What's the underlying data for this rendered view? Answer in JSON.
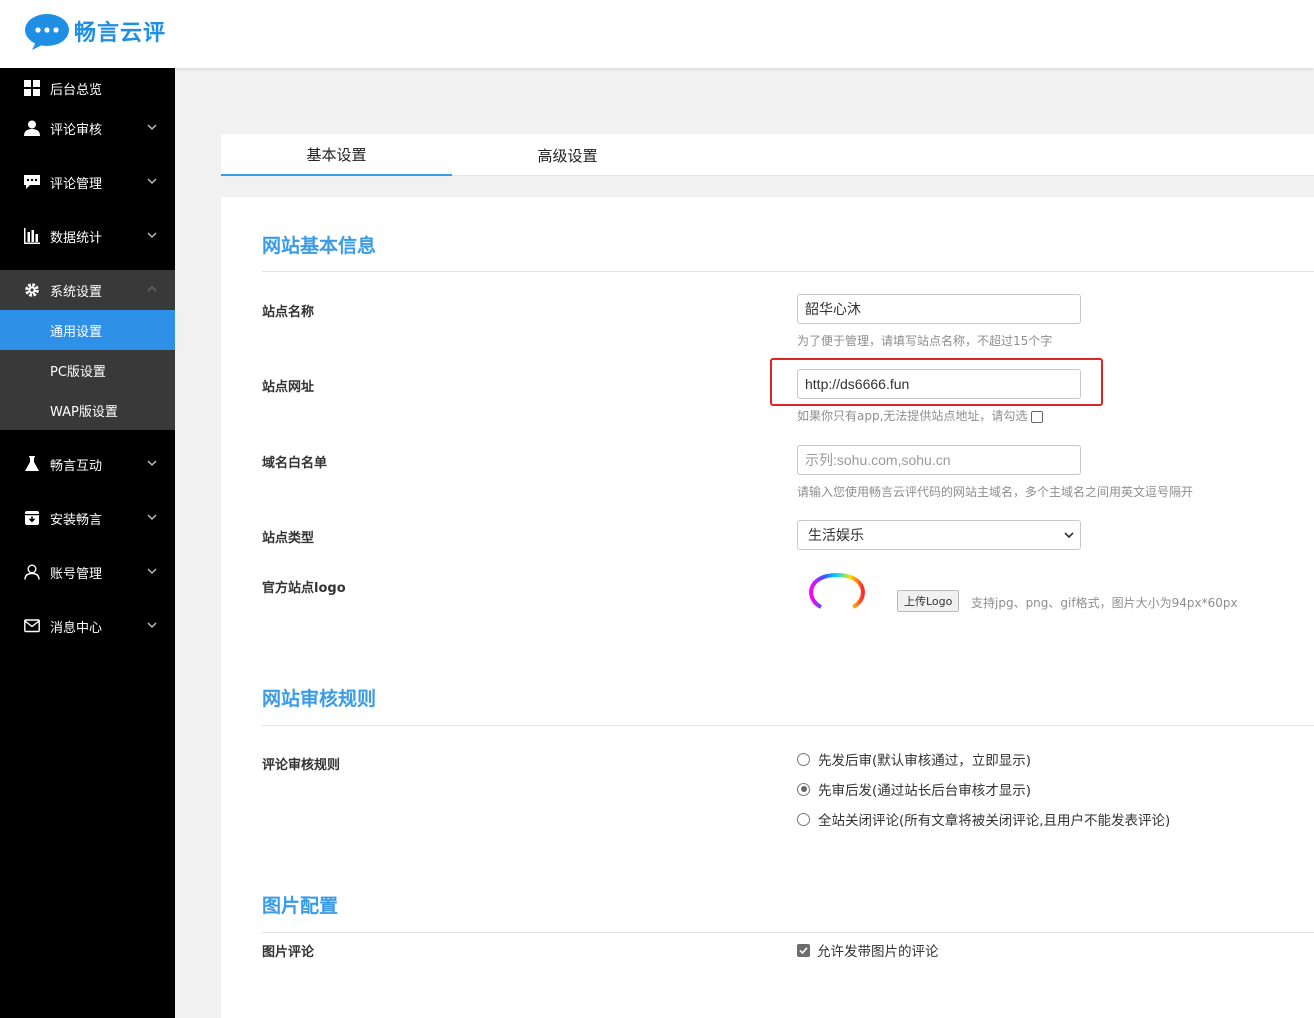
{
  "header": {
    "brand": "畅言云评"
  },
  "sidebar": {
    "items": [
      {
        "label": "后台总览",
        "icon": "dashboard-icon"
      },
      {
        "label": "评论审核",
        "icon": "user-icon"
      },
      {
        "label": "评论管理",
        "icon": "comment-icon"
      },
      {
        "label": "数据统计",
        "icon": "bar-chart-icon"
      },
      {
        "label": "系统设置",
        "icon": "gear-icon"
      },
      {
        "label": "畅言互动",
        "icon": "flask-icon"
      },
      {
        "label": "安装畅言",
        "icon": "install-icon"
      },
      {
        "label": "账号管理",
        "icon": "account-icon"
      },
      {
        "label": "消息中心",
        "icon": "mail-icon"
      }
    ],
    "sub_items": [
      "通用设置",
      "PC版设置",
      "WAP版设置"
    ]
  },
  "tabs": [
    "基本设置",
    "高级设置"
  ],
  "sections": {
    "basic_info": "网站基本信息",
    "review_rules": "网站审核规则",
    "image_config": "图片配置"
  },
  "form": {
    "site_name": {
      "label": "站点名称",
      "value": "韶华心沐",
      "hint": "为了便于管理，请填写站点名称，不超过15个字"
    },
    "site_url": {
      "label": "站点网址",
      "value": "http://ds6666.fun",
      "hint": "如果你只有app,无法提供站点地址，请勾选"
    },
    "whitelist": {
      "label": "域名白名单",
      "placeholder": "示列:sohu.com,sohu.cn",
      "hint": "请输入您使用畅言云评代码的网站主域名，多个主域名之间用英文逗号隔开"
    },
    "site_type": {
      "label": "站点类型",
      "value": "生活娱乐"
    },
    "site_logo": {
      "label": "官方站点logo",
      "button": "上传Logo",
      "hint": "支持jpg、png、gif格式，图片大小为94px*60px"
    },
    "review_rule": {
      "label": "评论审核规则",
      "options": [
        "先发后审(默认审核通过，立即显示)",
        "先审后发(通过站长后台审核才显示)",
        "全站关闭评论(所有文章将被关闭评论,且用户不能发表评论)"
      ],
      "selected": 1
    },
    "image_comment": {
      "label": "图片评论",
      "checkbox": "允许发带图片的评论",
      "checked": true
    }
  }
}
